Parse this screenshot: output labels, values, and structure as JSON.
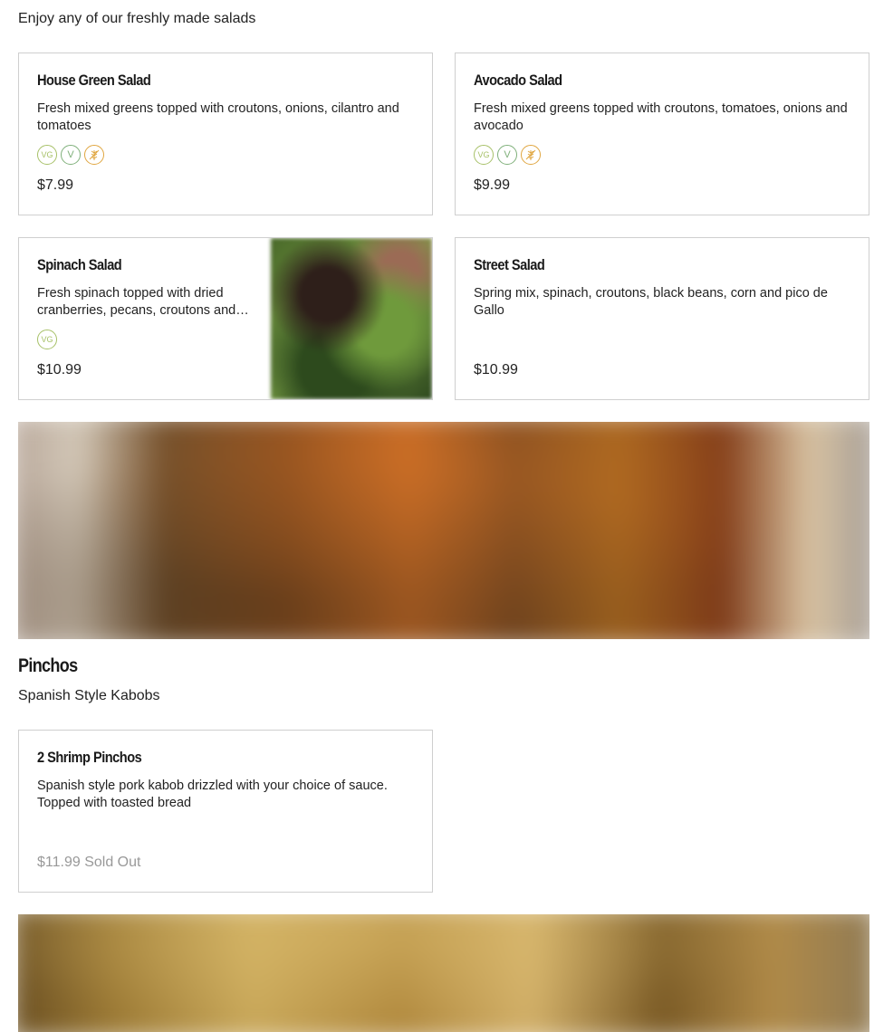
{
  "salads": {
    "description": "Enjoy any of our freshly made salads",
    "items": [
      {
        "name": "House Green Salad",
        "description": "Fresh mixed greens topped with croutons, onions, cilantro and tomatoes",
        "badges": [
          "VG",
          "V",
          "gluten-free-icon"
        ],
        "price": "$7.99"
      },
      {
        "name": "Avocado Salad",
        "description": "Fresh mixed greens topped with croutons, tomatoes, onions and avocado",
        "badges": [
          "VG",
          "V",
          "gluten-free-icon"
        ],
        "price": "$9.99"
      },
      {
        "name": "Spinach Salad",
        "description": "Fresh spinach topped with dried cranberries, pecans, croutons and…",
        "badges": [
          "VG"
        ],
        "price": "$10.99"
      },
      {
        "name": "Street Salad",
        "description": "Spring mix, spinach, croutons, black beans, corn and pico de Gallo",
        "badges": [],
        "price": "$10.99"
      }
    ]
  },
  "pinchos": {
    "title": "Pinchos",
    "description": "Spanish Style Kabobs",
    "items": [
      {
        "name": "2 Shrimp Pinchos",
        "description": "Spanish style pork kabob drizzled with your choice of sauce. Topped with toasted bread",
        "price": "$11.99",
        "status": "Sold Out"
      }
    ]
  },
  "badge_labels": {
    "vegan": "VG",
    "vegetarian": "V"
  },
  "colors": {
    "vegan_badge": "#a7c168",
    "vegetarian_badge": "#7fb07a",
    "gluten_free_badge": "#e0a640",
    "sold_out_text": "#999999",
    "card_border": "#cfcfcf"
  }
}
